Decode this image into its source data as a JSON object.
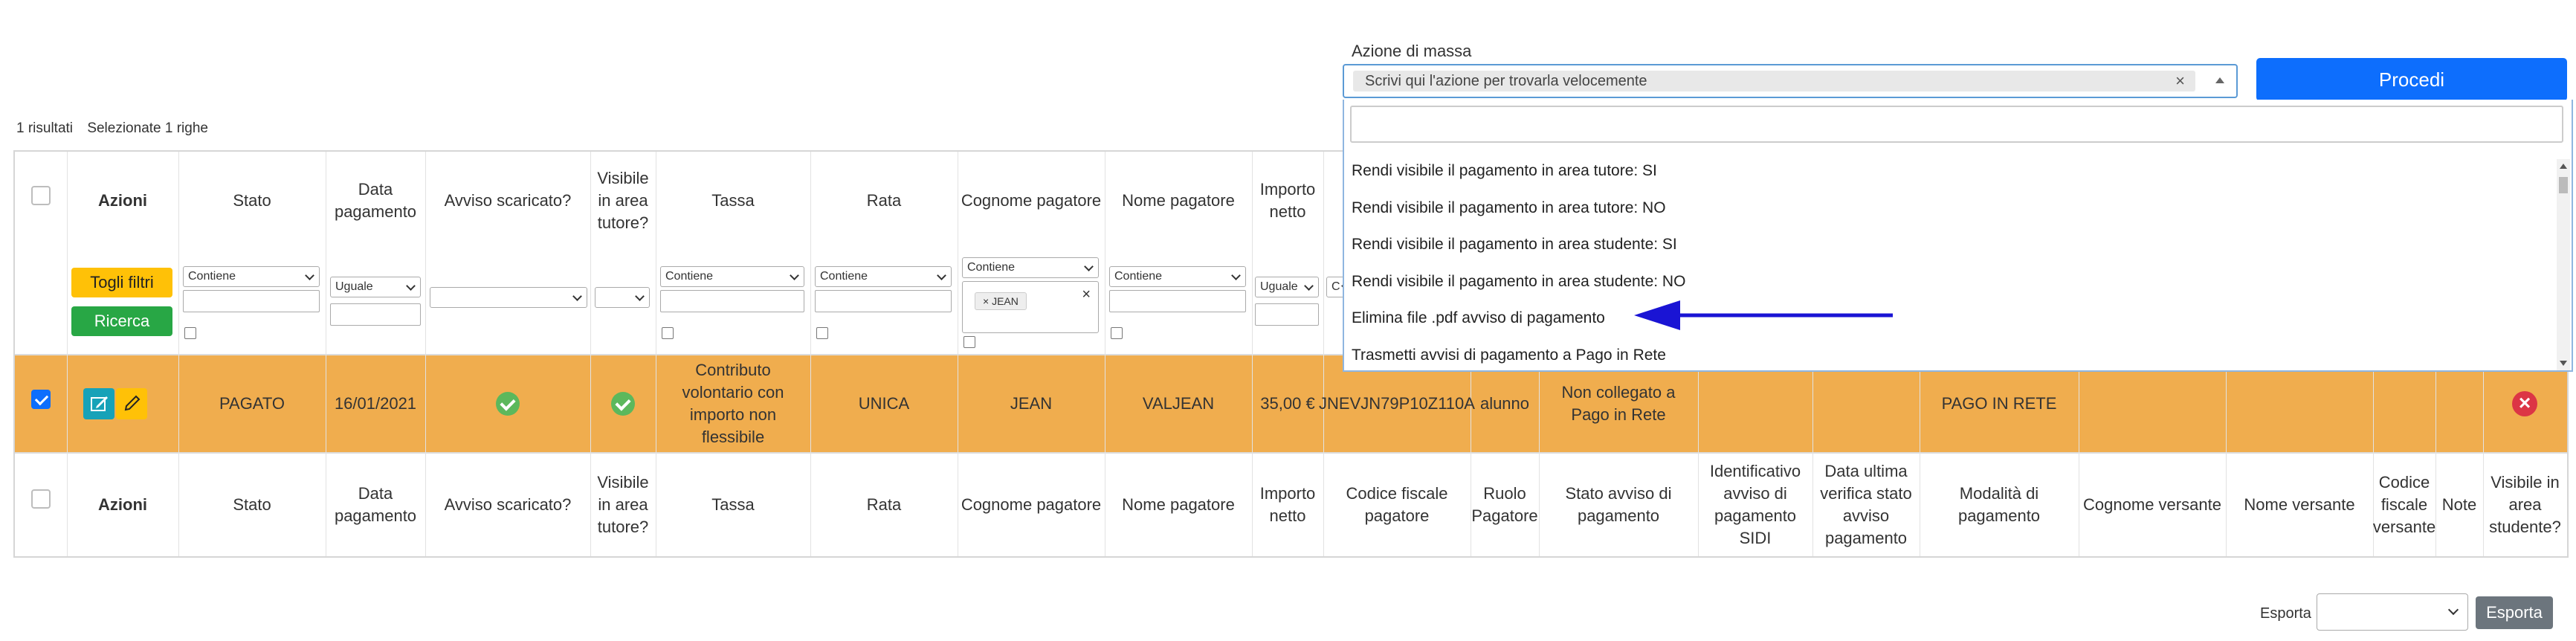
{
  "mass_action": {
    "label": "Azione di massa",
    "placeholder_chip": "Scrivi qui l'azione per trovarla velocemente",
    "clear_symbol": "×",
    "proceed_label": "Procedi"
  },
  "dropdown": {
    "search_value": "",
    "options": [
      "Rendi visibile il pagamento in area tutore: SI",
      "Rendi visibile il pagamento in area tutore: NO",
      "Rendi visibile il pagamento in area studente: SI",
      "Rendi visibile il pagamento in area studente: NO",
      "Elimina file .pdf avviso di pagamento",
      "Trasmetti avvisi di pagamento a Pago in Rete"
    ]
  },
  "results": {
    "count": "1 risultati",
    "selected": "Selezionate 1 righe"
  },
  "table": {
    "headers": [
      "Azioni",
      "Stato",
      "Data pagamento",
      "Avviso scaricato?",
      "Visibile in area tutore?",
      "Tassa",
      "Rata",
      "Cognome pagatore",
      "Nome pagatore",
      "Importo netto"
    ],
    "footers": [
      "Azioni",
      "Stato",
      "Data pagamento",
      "Avviso scaricato?",
      "Visibile in area tutore?",
      "Tassa",
      "Rata",
      "Cognome pagatore",
      "Nome pagatore",
      "Importo netto",
      "Codice fiscale pagatore",
      "Ruolo Pagatore",
      "Stato avviso di pagamento",
      "Identificativo avviso di pagamento SIDI",
      "Data ultima verifica stato avviso pagamento",
      "Modalità di pagamento",
      "Cognome versante",
      "Nome versante",
      "Codice fiscale versante",
      "Note",
      "Visibile in area studente?"
    ],
    "filters": {
      "clear_filters": "Togli filtri",
      "search": "Ricerca",
      "stato_op": "Contiene",
      "data_op": "Uguale",
      "tassa_op": "Contiene",
      "rata_op": "Contiene",
      "cognome_op": "Contiene",
      "cognome_tag": "JEAN",
      "tag_x": "×",
      "nome_op": "Contiene",
      "importo_op": "Uguale",
      "cf_op_partial": "C"
    },
    "row": {
      "stato": "PAGATO",
      "data": "16/01/2021",
      "tassa": "Contributo volontario con importo non flessibile",
      "rata": "UNICA",
      "cognome": "JEAN",
      "nome": "VALJEAN",
      "importo": "35,00 €",
      "cf": "JNEVJN79P10Z110A",
      "ruolo": "alunno",
      "stato_avviso": "Non collegato a Pago in Rete",
      "modalita": "PAGO IN RETE",
      "delete_symbol": "×"
    }
  },
  "export": {
    "label": "Esporta",
    "button": "Esporta",
    "selected": ""
  },
  "colors": {
    "row_highlight": "#f0ad4e",
    "primary": "#0d6efd",
    "annotation_arrow": "#1a14d4"
  }
}
